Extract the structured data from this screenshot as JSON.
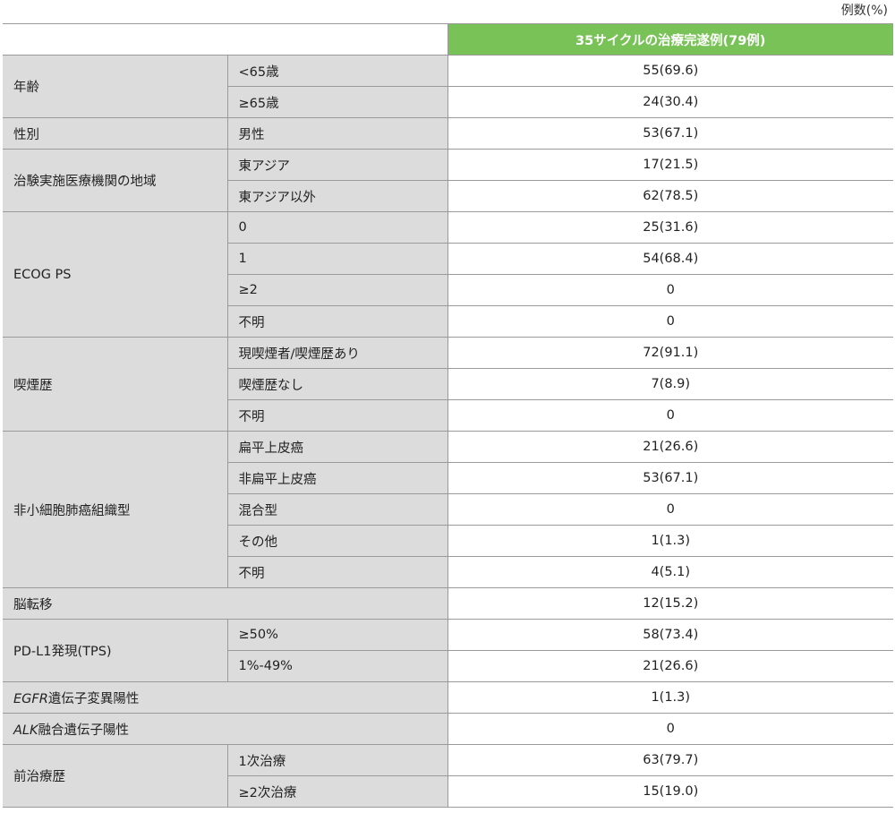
{
  "unit_note": "例数(%)",
  "header": {
    "column_label": "35サイクルの治療完遂例(79例)"
  },
  "rows": [
    {
      "category": "年齢",
      "items": [
        {
          "label": "<65歳",
          "value": "55(69.6)"
        },
        {
          "label": "≥65歳",
          "value": "24(30.4)"
        }
      ]
    },
    {
      "category": "性別",
      "items": [
        {
          "label": "男性",
          "value": "53(67.1)"
        }
      ]
    },
    {
      "category": "治験実施医療機関の地域",
      "items": [
        {
          "label": "東アジア",
          "value": "17(21.5)"
        },
        {
          "label": "東アジア以外",
          "value": "62(78.5)"
        }
      ]
    },
    {
      "category": "ECOG PS",
      "items": [
        {
          "label": "0",
          "value": "25(31.6)"
        },
        {
          "label": "1",
          "value": "54(68.4)"
        },
        {
          "label": "≥2",
          "value": "0"
        },
        {
          "label": "不明",
          "value": "0"
        }
      ]
    },
    {
      "category": "喫煙歴",
      "items": [
        {
          "label": "現喫煙者/喫煙歴あり",
          "value": "72(91.1)"
        },
        {
          "label": "喫煙歴なし",
          "value": "7(8.9)"
        },
        {
          "label": "不明",
          "value": "0"
        }
      ]
    },
    {
      "category": "非小細胞肺癌組織型",
      "items": [
        {
          "label": "扁平上皮癌",
          "value": "21(26.6)"
        },
        {
          "label": "非扁平上皮癌",
          "value": "53(67.1)"
        },
        {
          "label": "混合型",
          "value": "0"
        },
        {
          "label": "その他",
          "value": "1(1.3)"
        },
        {
          "label": "不明",
          "value": "4(5.1)"
        }
      ]
    },
    {
      "category": "脳転移",
      "items": [
        {
          "label": "",
          "value": "12(15.2)"
        }
      ]
    },
    {
      "category": "PD-L1発現(TPS)",
      "items": [
        {
          "label": "≥50%",
          "value": "58(73.4)"
        },
        {
          "label": "1%-49%",
          "value": "21(26.6)"
        }
      ]
    },
    {
      "category": "遺伝子変異陽性",
      "category_italic_prefix": "EGFR",
      "items": [
        {
          "label": "",
          "value": "1(1.3)"
        }
      ]
    },
    {
      "category": "融合遺伝子陽性",
      "category_italic_prefix": "ALK",
      "items": [
        {
          "label": "",
          "value": "0"
        }
      ]
    },
    {
      "category": "前治療歴",
      "items": [
        {
          "label": "1次治療",
          "value": "63(79.7)"
        },
        {
          "label": "≥2次治療",
          "value": "15(19.0)"
        }
      ]
    }
  ]
}
